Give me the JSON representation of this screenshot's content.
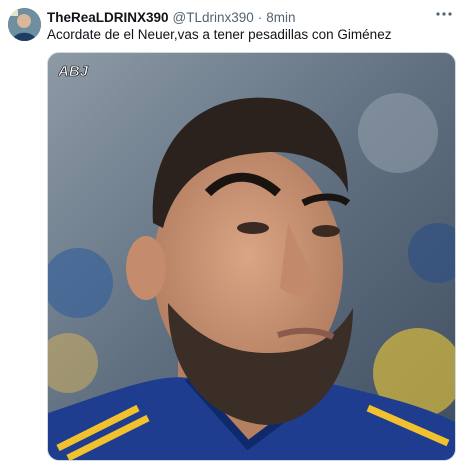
{
  "author": {
    "display_name": "TheReaLDRINX390",
    "handle": "@TLdrinx390",
    "separator": "·",
    "time": "8min"
  },
  "tweet_text": "Acordate de el Neuer,vas a tener pesadillas con Giménez",
  "media": {
    "watermark": "ABJ"
  },
  "icons": {
    "more": "more-options-icon"
  }
}
